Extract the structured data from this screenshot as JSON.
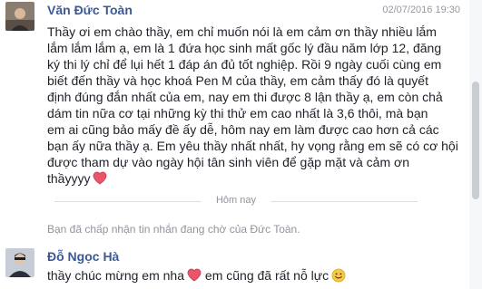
{
  "messages": [
    {
      "sender": "Văn Đức Toàn",
      "timestamp": "02/07/2016 19:30",
      "text": "Thầy ơi em chào thầy, em chỉ muốn nói là em cảm ơn thầy nhiều lắm\nlắm lắm lắm ạ, em là 1 đứa học sinh mất gốc lý đầu năm lớp 12, đăng\nký thi lý chỉ để lụi hết 1 đáp án đủ tốt nghiệp. Rồi 9 ngày cuối cùng em\nbiết đến thầy và học khoá Pen M của thầy, em cảm thấy đó là quyết\nđịnh đúng đắn nhất của em, nay em thi được 8 lận thầy ạ, em còn chả\ndám tin nữa cơ tại những kỳ thi thử em cao nhất là 3,6 thôi, mà bạn\nem ai cũng bảo mấy đề ấy dễ, hôm nay em làm được cao hơn cả các\nbạn ấy nữa thầy ạ. Em yêu thầy nhất nhất, hy vọng rằng em sẽ có cơ hội\nđược tham dự vào ngày hội tân sinh viên để gặp mặt và cảm ơn\nthầyyyy",
      "icon": "heart-icon"
    },
    {
      "sender": "Đỗ Ngọc Hà",
      "text_part1": "thầy chúc mừng em nha",
      "text_part2": "em cũng đã rất nỗ lực",
      "icons": [
        "heart-icon",
        "smile-icon"
      ]
    }
  ],
  "divider": {
    "label": "Hôm nay"
  },
  "system_note": "Bạn đã chấp nhận tin nhắn đang chờ của Đức Toàn.",
  "colors": {
    "sender_name": "#3b5998",
    "heart": "#e9566b",
    "smile": "#f7c948",
    "meta_text": "#90949c"
  }
}
